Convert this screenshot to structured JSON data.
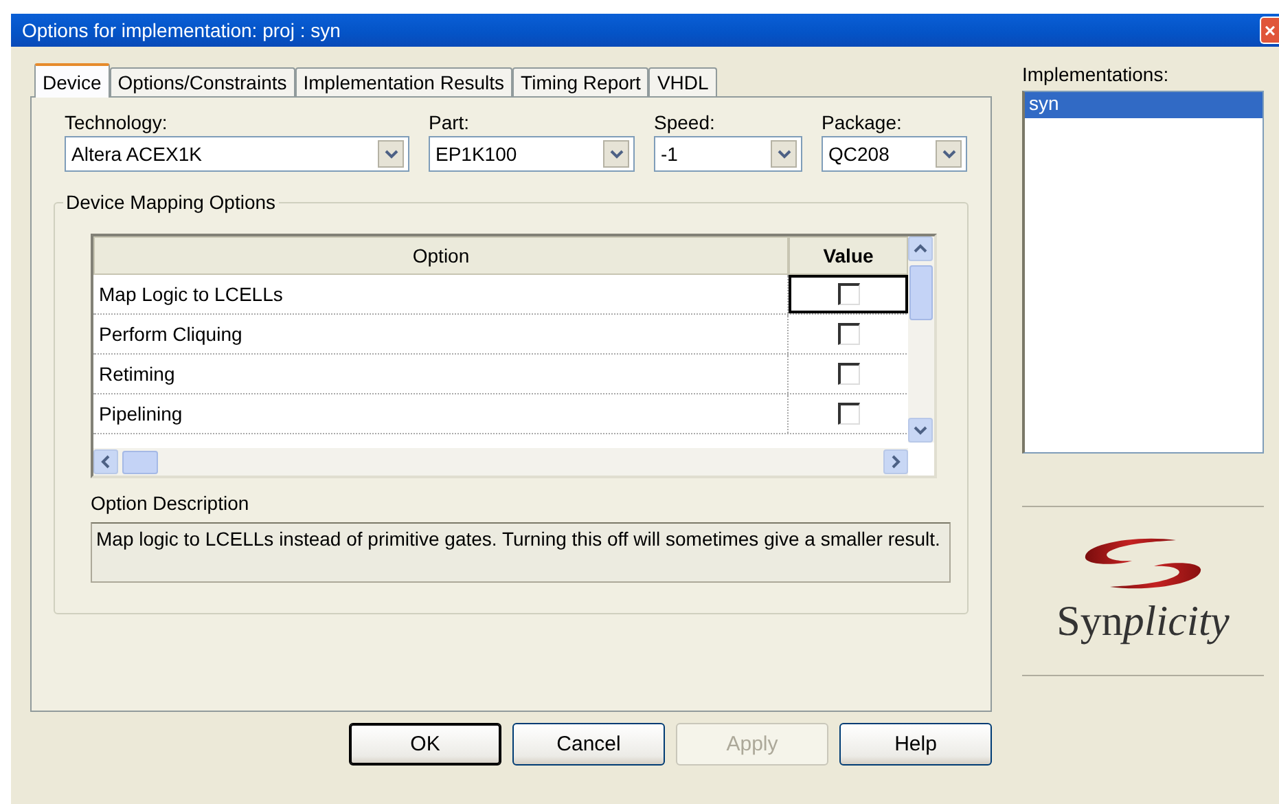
{
  "window": {
    "title": "Options for implementation: proj : syn",
    "close": "×"
  },
  "tabs": [
    {
      "label": "Device",
      "selected": true
    },
    {
      "label": "Options/Constraints",
      "selected": false
    },
    {
      "label": "Implementation Results",
      "selected": false
    },
    {
      "label": "Timing Report",
      "selected": false
    },
    {
      "label": "VHDL",
      "selected": false
    }
  ],
  "selectors": [
    {
      "label": "Technology:",
      "value": "Altera ACEX1K"
    },
    {
      "label": "Part:",
      "value": "EP1K100"
    },
    {
      "label": "Speed:",
      "value": "-1"
    },
    {
      "label": "Package:",
      "value": "QC208"
    }
  ],
  "mapping_group": {
    "title": "Device Mapping Options",
    "table": {
      "columns": [
        "Option",
        "Value"
      ],
      "rows": [
        {
          "option": "Map Logic to LCELLs",
          "checked": false,
          "focused": true
        },
        {
          "option": "Perform Cliquing",
          "checked": false,
          "focused": false
        },
        {
          "option": "Retiming",
          "checked": false,
          "focused": false
        },
        {
          "option": "Pipelining",
          "checked": false,
          "focused": false
        }
      ]
    },
    "description_label": "Option Description",
    "description": "Map logic to LCELLs instead of primitive gates. Turning this off will sometimes give a smaller result."
  },
  "implementations": {
    "label": "Implementations:",
    "items": [
      {
        "name": "syn",
        "selected": true
      }
    ]
  },
  "logo": {
    "parts": [
      {
        "text": "Syn",
        "italic": false
      },
      {
        "text": "plicity",
        "italic": true
      }
    ]
  },
  "buttons": [
    {
      "label": "OK",
      "disabled": false,
      "default": true
    },
    {
      "label": "Cancel",
      "disabled": false,
      "default": false
    },
    {
      "label": "Apply",
      "disabled": true,
      "default": false
    },
    {
      "label": "Help",
      "disabled": false,
      "default": false
    }
  ]
}
